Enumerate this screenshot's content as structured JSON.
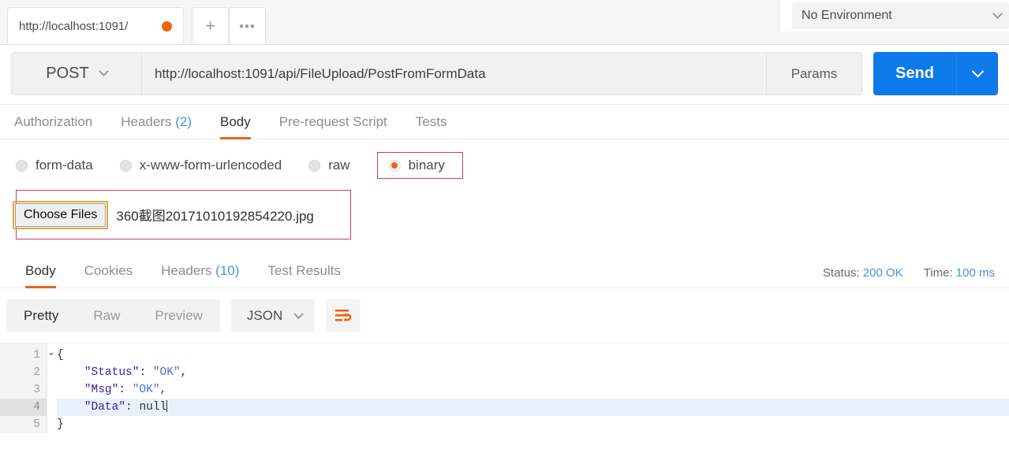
{
  "tabbar": {
    "request_tab_label": "http://localhost:1091/",
    "unsaved_indicator": "unsaved-dot",
    "new_tab_label": "+",
    "more_label": "•••",
    "environment": {
      "selected": "No Environment",
      "chevron": "chevron-down-icon"
    }
  },
  "urlbar": {
    "method": "POST",
    "url": "http://localhost:1091/api/FileUpload/PostFromFormData",
    "params_label": "Params",
    "send_label": "Send",
    "send_caret": "chevron-down-icon"
  },
  "request_tabs": [
    {
      "label": "Authorization",
      "count": "",
      "active": false
    },
    {
      "label": "Headers",
      "count": "(2)",
      "active": false
    },
    {
      "label": "Body",
      "count": "",
      "active": true
    },
    {
      "label": "Pre-request Script",
      "count": "",
      "active": false
    },
    {
      "label": "Tests",
      "count": "",
      "active": false
    }
  ],
  "body_modes": [
    {
      "label": "form-data",
      "selected": false,
      "highlighted": false
    },
    {
      "label": "x-www-form-urlencoded",
      "selected": false,
      "highlighted": false
    },
    {
      "label": "raw",
      "selected": false,
      "highlighted": false
    },
    {
      "label": "binary",
      "selected": true,
      "highlighted": true
    }
  ],
  "file_picker": {
    "button_label": "Choose Files",
    "file_name": "360截图20171010192854220.jpg"
  },
  "response_tabs": [
    {
      "label": "Body",
      "count": "",
      "active": true
    },
    {
      "label": "Cookies",
      "count": "",
      "active": false
    },
    {
      "label": "Headers",
      "count": "(10)",
      "active": false
    },
    {
      "label": "Test Results",
      "count": "",
      "active": false
    }
  ],
  "response_meta": {
    "status_label": "Status:",
    "status_value": "200 OK",
    "time_label": "Time:",
    "time_value": "100 ms"
  },
  "pretty_bar": {
    "views": [
      {
        "label": "Pretty",
        "active": true
      },
      {
        "label": "Raw",
        "active": false
      },
      {
        "label": "Preview",
        "active": false
      }
    ],
    "format": "JSON",
    "format_caret": "chevron-down-icon",
    "wrap_icon": "word-wrap-icon"
  },
  "response_body": {
    "line_numbers": [
      "1",
      "2",
      "3",
      "4",
      "5"
    ],
    "current_line": 4,
    "lines": [
      {
        "indent": 0,
        "tokens": [
          {
            "t": "p",
            "v": "{"
          }
        ]
      },
      {
        "indent": 1,
        "tokens": [
          {
            "t": "k",
            "v": "\"Status\""
          },
          {
            "t": "p",
            "v": ": "
          },
          {
            "t": "s",
            "v": "\"OK\""
          },
          {
            "t": "p",
            "v": ","
          }
        ]
      },
      {
        "indent": 1,
        "tokens": [
          {
            "t": "k",
            "v": "\"Msg\""
          },
          {
            "t": "p",
            "v": ": "
          },
          {
            "t": "s",
            "v": "\"OK\""
          },
          {
            "t": "p",
            "v": ","
          }
        ]
      },
      {
        "indent": 1,
        "tokens": [
          {
            "t": "k",
            "v": "\"Data\""
          },
          {
            "t": "p",
            "v": ": "
          },
          {
            "t": "p",
            "v": "null"
          }
        ]
      },
      {
        "indent": 0,
        "tokens": [
          {
            "t": "p",
            "v": "}"
          }
        ]
      }
    ]
  },
  "colors": {
    "accent_orange": "#ef6113",
    "send_blue": "#0e79e8",
    "link_blue": "#4a90d9",
    "highlight_red": "#c2415a",
    "focus_gold": "#e0a93b"
  }
}
